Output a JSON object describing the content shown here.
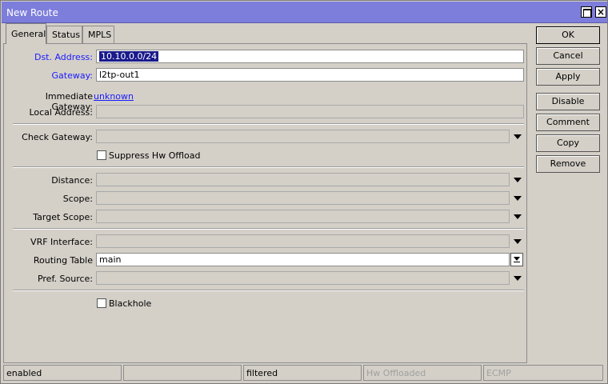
{
  "window": {
    "title": "New Route"
  },
  "tabs": [
    {
      "label": "General",
      "active": true
    },
    {
      "label": "Status"
    },
    {
      "label": "MPLS"
    }
  ],
  "form": {
    "dst_address": {
      "label": "Dst. Address:",
      "value": "10.10.0.0/24"
    },
    "gateway": {
      "label": "Gateway:",
      "value": "l2tp-out1"
    },
    "immediate_gateway": {
      "label": "Immediate Gateway:",
      "value": "unknown"
    },
    "local_address": {
      "label": "Local Address:",
      "value": ""
    },
    "check_gateway": {
      "label": "Check Gateway:",
      "value": ""
    },
    "suppress_hw_offload": {
      "label": "Suppress Hw Offload",
      "checked": false
    },
    "distance": {
      "label": "Distance:",
      "value": ""
    },
    "scope": {
      "label": "Scope:",
      "value": ""
    },
    "target_scope": {
      "label": "Target Scope:",
      "value": ""
    },
    "vrf_interface": {
      "label": "VRF Interface:",
      "value": ""
    },
    "routing_table": {
      "label": "Routing Table",
      "value": "main"
    },
    "pref_source": {
      "label": "Pref. Source:",
      "value": ""
    },
    "blackhole": {
      "label": "Blackhole",
      "checked": false
    }
  },
  "buttons": {
    "ok": "OK",
    "cancel": "Cancel",
    "apply": "Apply",
    "disable": "Disable",
    "comment": "Comment",
    "copy": "Copy",
    "remove": "Remove"
  },
  "status": {
    "state": "enabled",
    "blank": "",
    "filtered": "filtered",
    "hw_offloaded": "Hw Offloaded",
    "ecmp": "ECMP"
  },
  "colors": {
    "title_bar": "#7d7ddc",
    "dialog_bg": "#d4d0c8",
    "link": "#1a1aff",
    "selection": "#1a1a8c"
  }
}
